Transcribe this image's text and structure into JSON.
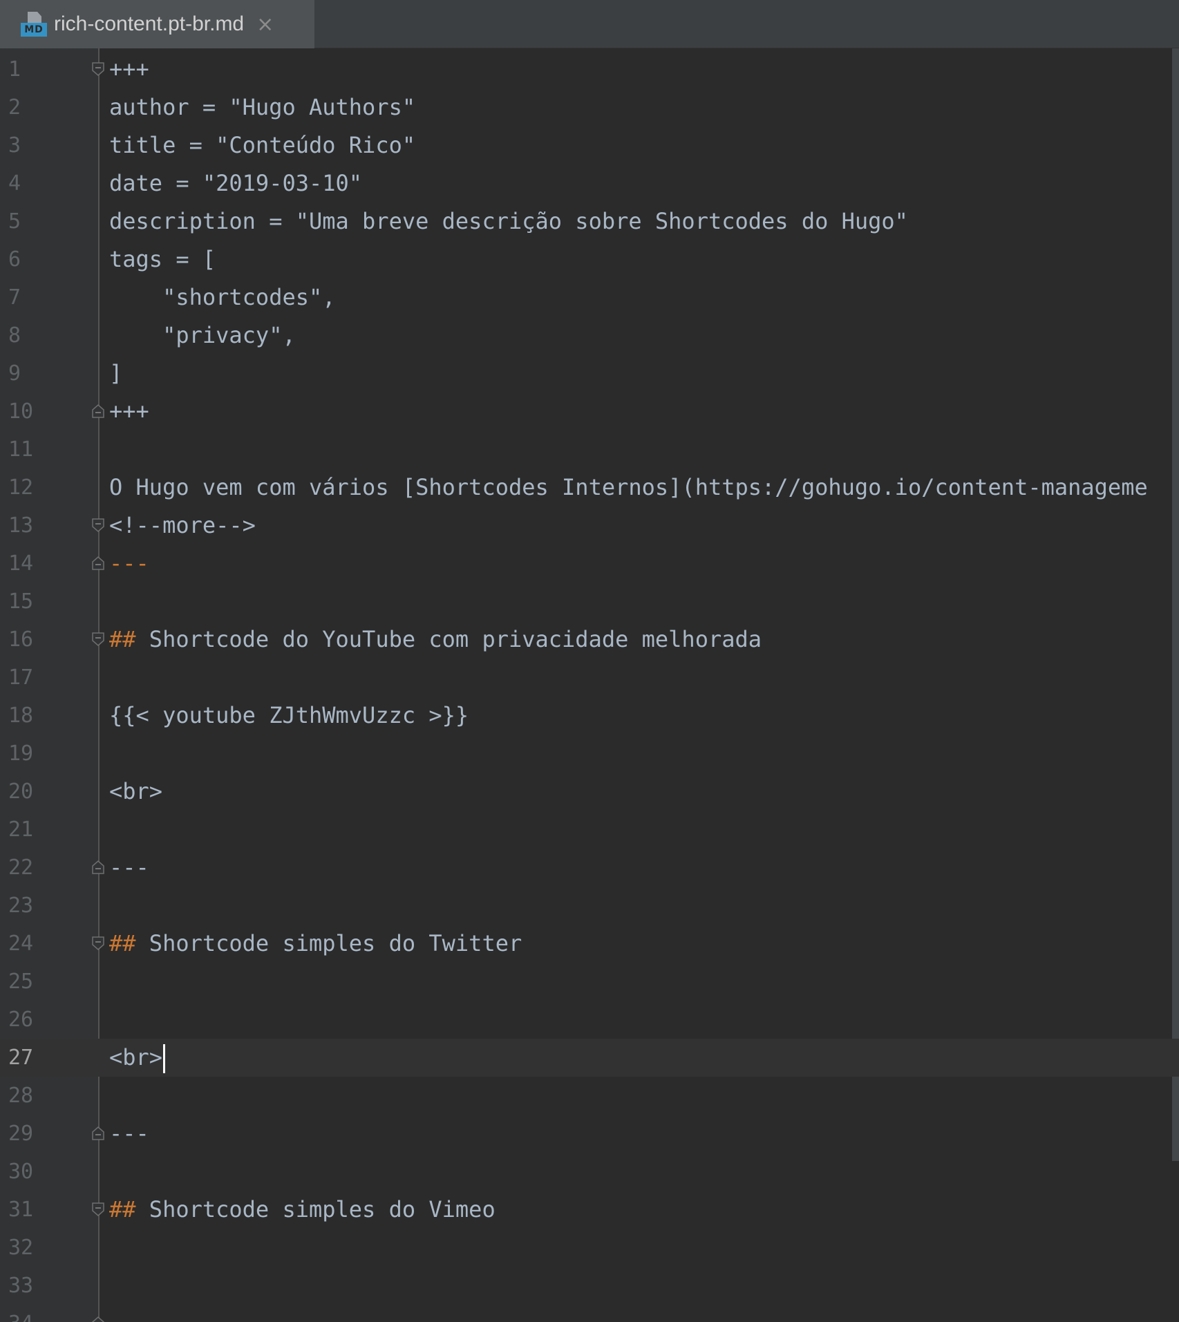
{
  "tab": {
    "icon": "markdown-file-icon",
    "icon_badge": "MD",
    "title": "rich-content.pt-br.md",
    "close_glyph": "×"
  },
  "editor": {
    "current_line": 27,
    "lines": [
      {
        "n": "1",
        "fold": "start",
        "seg": [
          {
            "t": "+++"
          }
        ]
      },
      {
        "n": "2",
        "seg": [
          {
            "t": "author = \"Hugo Authors\""
          }
        ]
      },
      {
        "n": "3",
        "seg": [
          {
            "t": "title = \"Conteúdo Rico\""
          }
        ]
      },
      {
        "n": "4",
        "seg": [
          {
            "t": "date = \"2019-03-10\""
          }
        ]
      },
      {
        "n": "5",
        "seg": [
          {
            "t": "description = \"Uma breve descrição sobre Shortcodes do Hugo\""
          }
        ]
      },
      {
        "n": "6",
        "seg": [
          {
            "t": "tags = ["
          }
        ]
      },
      {
        "n": "7",
        "seg": [
          {
            "t": "    \"shortcodes\","
          }
        ]
      },
      {
        "n": "8",
        "seg": [
          {
            "t": "    \"privacy\","
          }
        ]
      },
      {
        "n": "9",
        "seg": [
          {
            "t": "]"
          }
        ]
      },
      {
        "n": "10",
        "fold": "end",
        "seg": [
          {
            "t": "+++"
          }
        ]
      },
      {
        "n": "11",
        "seg": []
      },
      {
        "n": "12",
        "seg": [
          {
            "t": "O Hugo vem com vários [Shortcodes Internos](https://gohugo.io/content-manageme"
          }
        ]
      },
      {
        "n": "13",
        "fold": "start",
        "seg": [
          {
            "t": "<!--more-->"
          }
        ]
      },
      {
        "n": "14",
        "fold": "end",
        "seg": [
          {
            "t": "---",
            "hl": true
          }
        ]
      },
      {
        "n": "15",
        "seg": []
      },
      {
        "n": "16",
        "fold": "start",
        "seg": [
          {
            "t": "##",
            "hl": true
          },
          {
            "t": " Shortcode do YouTube com privacidade melhorada"
          }
        ]
      },
      {
        "n": "17",
        "seg": []
      },
      {
        "n": "18",
        "seg": [
          {
            "t": "{{< youtube ZJthWmvUzzc >}}"
          }
        ]
      },
      {
        "n": "19",
        "seg": []
      },
      {
        "n": "20",
        "seg": [
          {
            "t": "<br>"
          }
        ]
      },
      {
        "n": "21",
        "seg": []
      },
      {
        "n": "22",
        "fold": "end",
        "seg": [
          {
            "t": "---"
          }
        ]
      },
      {
        "n": "23",
        "seg": []
      },
      {
        "n": "24",
        "fold": "start",
        "seg": [
          {
            "t": "##",
            "hl": true
          },
          {
            "t": " Shortcode simples do Twitter"
          }
        ]
      },
      {
        "n": "25",
        "seg": []
      },
      {
        "n": "26",
        "seg": []
      },
      {
        "n": "27",
        "seg": [
          {
            "t": "<br>"
          }
        ]
      },
      {
        "n": "28",
        "seg": []
      },
      {
        "n": "29",
        "fold": "end",
        "seg": [
          {
            "t": "---"
          }
        ]
      },
      {
        "n": "30",
        "seg": []
      },
      {
        "n": "31",
        "fold": "start",
        "seg": [
          {
            "t": "##",
            "hl": true
          },
          {
            "t": " Shortcode simples do Vimeo"
          }
        ]
      },
      {
        "n": "32",
        "seg": []
      },
      {
        "n": "33",
        "seg": []
      },
      {
        "n": "34",
        "fold": "end",
        "seg": []
      }
    ]
  },
  "colors": {
    "background": "#2b2b2b",
    "gutter": "#313335",
    "text": "#a9b7c6",
    "markdown_markup": "#cc7832",
    "line_number": "#606366",
    "current_line": "#323232"
  }
}
